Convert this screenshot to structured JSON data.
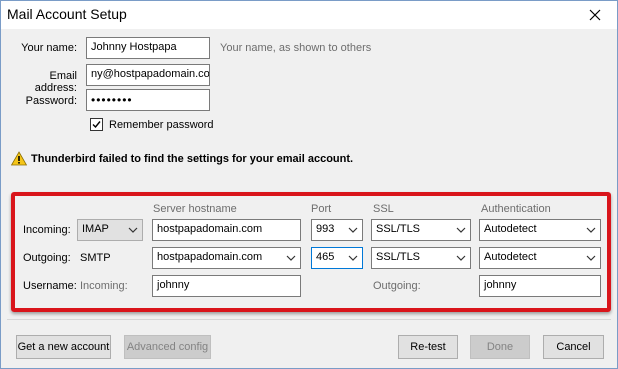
{
  "window": {
    "title": "Mail Account Setup"
  },
  "account": {
    "name_label": "Your name:",
    "name_value": "Johnny Hostpapa",
    "name_hint": "Your name, as shown to others",
    "email_label": "Email address:",
    "email_value": "ny@hostpapadomain.com",
    "password_label": "Password:",
    "password_value": "••••••••",
    "remember_label": "Remember password",
    "remember_checked": true
  },
  "warning": {
    "text": "Thunderbird failed to find the settings for your email account."
  },
  "server": {
    "headers": {
      "hostname": "Server hostname",
      "port": "Port",
      "ssl": "SSL",
      "auth": "Authentication"
    },
    "incoming": {
      "label": "Incoming:",
      "protocol": "IMAP",
      "hostname": "hostpapadomain.com",
      "port": "993",
      "ssl": "SSL/TLS",
      "auth": "Autodetect"
    },
    "outgoing": {
      "label": "Outgoing:",
      "protocol": "SMTP",
      "hostname": "hostpapadomain.com",
      "port": "465",
      "ssl": "SSL/TLS",
      "auth": "Autodetect"
    },
    "username": {
      "label": "Username:",
      "incoming_label": "Incoming:",
      "incoming_value": "johnny",
      "outgoing_label": "Outgoing:",
      "outgoing_value": "johnny"
    }
  },
  "buttons": {
    "new_account": "Get a new account",
    "advanced": "Advanced config",
    "retest": "Re-test",
    "done": "Done",
    "cancel": "Cancel"
  },
  "colors": {
    "highlight_box": "#d9151b",
    "focus_border": "#0078d7"
  }
}
